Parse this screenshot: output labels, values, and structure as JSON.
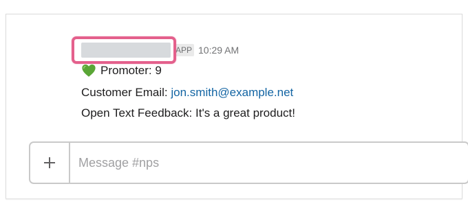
{
  "message": {
    "app_badge": "APP",
    "timestamp": "10:29 AM",
    "promoter": {
      "icon": "green-heart-icon",
      "text": "Promoter: 9"
    },
    "email_label": "Customer Email:",
    "email_value": "jon.smith@example.net",
    "feedback": "Open Text Feedback: It's a great product!"
  },
  "composer": {
    "plus_icon": "plus-icon",
    "placeholder": "Message #nps"
  },
  "colors": {
    "highlight": "#e4608c",
    "link": "#1264a3",
    "heart": "#5aa636"
  }
}
